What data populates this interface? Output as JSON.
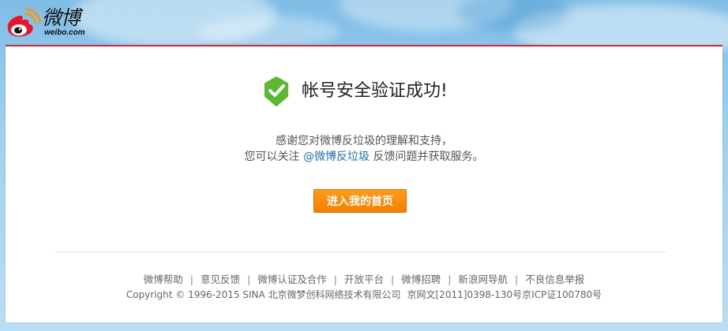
{
  "header": {
    "logo_cn": "微博",
    "logo_en": "weibo.com"
  },
  "main": {
    "title": "帐号安全验证成功!",
    "message_line1": "感谢您对微博反垃圾的理解和支持，",
    "message_line2_prefix": "您可以关注 ",
    "message_link": "@微博反垃圾",
    "message_line2_suffix": " 反馈问题并获取服务。",
    "button_label": "进入我的首页"
  },
  "footer": {
    "links": [
      "微博帮助",
      "意见反馈",
      "微博认证及合作",
      "开放平台",
      "微博招聘",
      "新浪网导航",
      "不良信息举报"
    ],
    "separator": "|",
    "copyright": "Copyright © 1996-2015 SINA 北京微梦创科网络技术有限公司",
    "icp": "京网文[2011]0398-130号京ICP证100780号"
  },
  "colors": {
    "accent_red": "#d3283a",
    "button_orange": "#f7870c",
    "success_green": "#5cb82e",
    "link_blue": "#1f6fb5"
  },
  "icons": [
    "weibo-logo-icon",
    "success-check-icon"
  ]
}
